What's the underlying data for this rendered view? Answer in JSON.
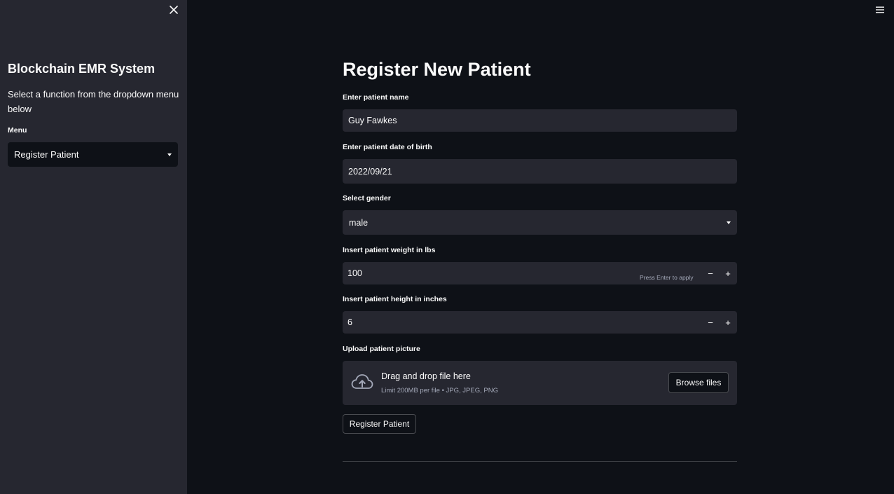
{
  "sidebar": {
    "title": "Blockchain EMR System",
    "description": "Select a function from the dropdown menu below",
    "menu_label": "Menu",
    "menu_selected": "Register Patient",
    "close_icon": "close-icon"
  },
  "header": {
    "menu_icon": "hamburger-menu-icon"
  },
  "main": {
    "title": "Register New Patient",
    "name_label": "Enter patient name",
    "name_value": "Guy Fawkes",
    "dob_label": "Enter patient date of birth",
    "dob_value": "2022/09/21",
    "gender_label": "Select gender",
    "gender_selected": "male",
    "weight_label": "Insert patient weight in lbs",
    "weight_value": "100",
    "weight_hint": "Press Enter to apply",
    "height_label": "Insert patient height in inches",
    "height_value": "6",
    "step_minus": "−",
    "step_plus": "+",
    "upload_label": "Upload patient picture",
    "upload_title": "Drag and drop file here",
    "upload_limit": "Limit 200MB per file • JPG, JPEG, PNG",
    "browse_label": "Browse files",
    "register_label": "Register Patient"
  },
  "colors": {
    "background": "#0e1117",
    "sidebar": "#262730",
    "input": "#262730",
    "text": "#fafafa",
    "muted": "#a3a8b8"
  }
}
